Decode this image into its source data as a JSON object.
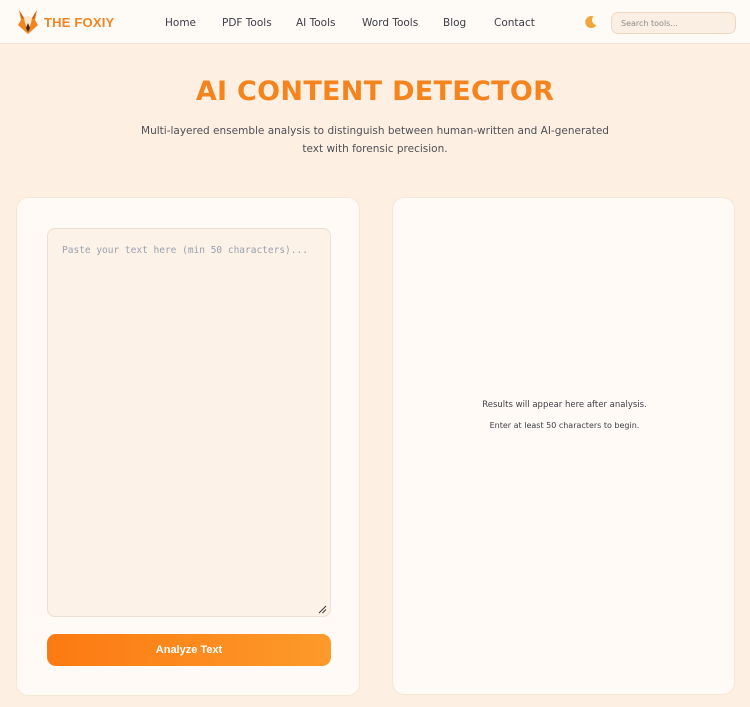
{
  "brand": {
    "name": "THE FOXIY",
    "logo_icon": "fox-logo-icon",
    "accent": "#f5841f"
  },
  "nav": {
    "links": [
      {
        "label": "Home"
      },
      {
        "label": "PDF Tools"
      },
      {
        "label": "AI Tools"
      },
      {
        "label": "Word Tools"
      },
      {
        "label": "Blog"
      },
      {
        "label": "Contact"
      }
    ],
    "theme_toggle_icon": "moon-icon",
    "search": {
      "placeholder": "Search tools...",
      "value": ""
    }
  },
  "hero": {
    "title": "AI CONTENT DETECTOR",
    "subtitle": "Multi-layered ensemble analysis to distinguish between human-written and AI-generated text with forensic precision."
  },
  "input_panel": {
    "textarea": {
      "placeholder": "Paste your text here (min 50 characters)...",
      "value": ""
    },
    "analyze_label": "Analyze Text",
    "button_gradient": [
      "#fc7a12",
      "#fd9a2a"
    ]
  },
  "results_panel": {
    "message": "Results will appear here after analysis.",
    "hint": "Enter at least 50 characters to begin."
  }
}
